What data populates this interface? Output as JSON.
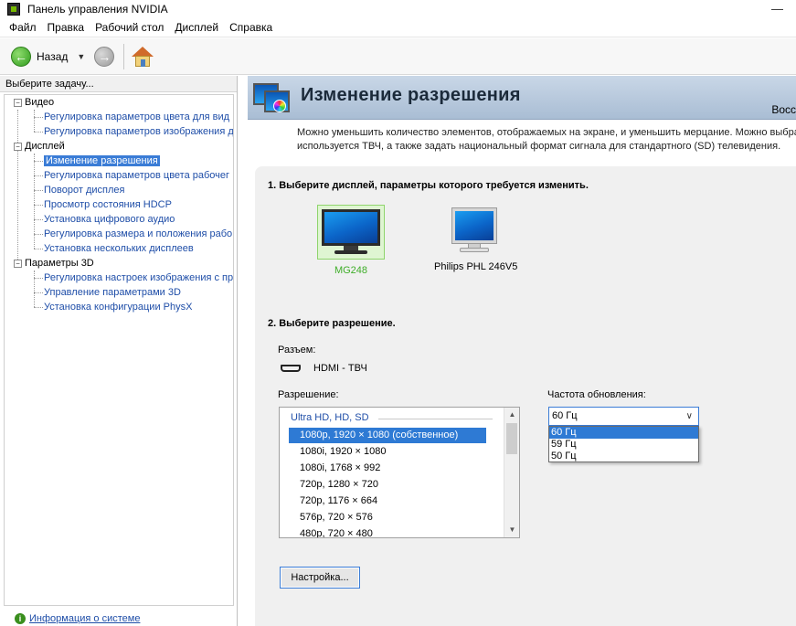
{
  "window": {
    "title": "Панель управления NVIDIA",
    "controls": "—"
  },
  "menu": [
    "Файл",
    "Правка",
    "Рабочий стол",
    "Дисплей",
    "Справка"
  ],
  "toolbar": {
    "back_label": "Назад"
  },
  "left": {
    "header": "Выберите задачу...",
    "categories": [
      {
        "label": "Видео",
        "items": [
          "Регулировка параметров цвета для вид",
          "Регулировка параметров изображения д"
        ]
      },
      {
        "label": "Дисплей",
        "items": [
          "Изменение разрешения",
          "Регулировка параметров цвета рабочег",
          "Поворот дисплея",
          "Просмотр состояния HDCP",
          "Установка цифрового аудио",
          "Регулировка размера и положения рабо",
          "Установка нескольких дисплеев"
        ]
      },
      {
        "label": "Параметры 3D",
        "items": [
          "Регулировка настроек изображения с пр",
          "Управление параметрами 3D",
          "Установка конфигурации PhysX"
        ]
      }
    ],
    "selected_item": "Изменение разрешения",
    "system_info": "Информация о системе"
  },
  "page": {
    "title": "Изменение разрешения",
    "restore": "Восс",
    "description_line1": "Можно уменьшить количество элементов, отображаемых на экране, и уменьшить мерцание. Можно выбра",
    "description_line2": "используется ТВЧ, а также задать национальный формат сигнала для стандартного (SD) телевидения.",
    "step1": "1. Выберите дисплей, параметры которого требуется изменить.",
    "displays": [
      {
        "name": "MG248",
        "selected": true
      },
      {
        "name": "Philips PHL 246V5",
        "selected": false
      }
    ],
    "step2": "2. Выберите разрешение.",
    "connector_label": "Разъем:",
    "connector_value": "HDMI - ТВЧ",
    "resolution_label": "Разрешение:",
    "resolution_group": "Ultra HD, HD, SD",
    "resolutions": [
      "1080p, 1920 × 1080 (собственное)",
      "1080i, 1920 × 1080",
      "1080i, 1768 × 992",
      "720p, 1280 × 720",
      "720p, 1176 × 664",
      "576p, 720 × 576",
      "480p, 720 × 480"
    ],
    "selected_resolution": "1080p, 1920 × 1080 (собственное)",
    "refresh_label": "Частота обновления:",
    "refresh_value": "60 Гц",
    "refresh_options": [
      "60 Гц",
      "59 Гц",
      "50 Гц"
    ],
    "settings_button": "Настройка..."
  },
  "colors": {
    "selection": "#2e7ad4",
    "link": "#1f4ea8",
    "nvidia_green": "#3fae29",
    "header_bg": "#b4c6db"
  }
}
